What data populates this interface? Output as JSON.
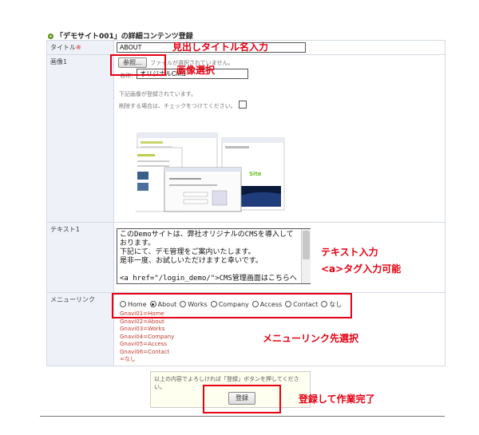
{
  "page": {
    "heading": "「デモサイト001」の詳細コンテンツ登録"
  },
  "form": {
    "title_label": "タイトル",
    "required_mark": "※",
    "title_value": "ABOUT",
    "image_label": "画像1",
    "browse_button": "参照...",
    "file_status": "ファイルが選択されていません。",
    "alt_label": "名称：",
    "alt_value": "オリジナルCMS",
    "registered_note": "下記画像が登録されています。",
    "delete_note": "削除する場合は、チェックをつけてください。",
    "text_label": "テキスト1",
    "text_value": "このDemoサイトは、弊社オリジナルのCMSを導入しております。\n下記にて、デモ管理をご案内いたします。\n是非一度、お試しいただけますと幸いです。\n\n<a href=\"/login_demo/\">CMS管理画面はこちらへ</a>\n<br>",
    "menu_label": "メニューリンク",
    "menu_options": [
      {
        "label": "Home",
        "checked": false
      },
      {
        "label": "About",
        "checked": true
      },
      {
        "label": "Works",
        "checked": false
      },
      {
        "label": "Company",
        "checked": false
      },
      {
        "label": "Access",
        "checked": false
      },
      {
        "label": "Contact",
        "checked": false
      },
      {
        "label": "なし",
        "checked": false
      }
    ],
    "menu_legend": [
      "Gnavi01=Home",
      "Gnavi02=About",
      "Gnavi03=Works",
      "Gnavi04=Company",
      "Gnavi05=Access",
      "Gnavi06=Contact",
      "=なし"
    ]
  },
  "submit": {
    "notice": "以上の内容でよろしければ「登録」ボタンを押してください。",
    "button": "登録"
  },
  "annotations": {
    "title_input": "見出しタイトル名入力",
    "image_select": "画像選択",
    "text_input_1": "テキスト入力",
    "text_input_2": "<a>タグ入力可能",
    "menu_select": "メニューリンク先選択",
    "register_done": "登録して作業完了"
  },
  "thumbnail": {
    "site_label": "Site"
  },
  "colors": {
    "annotation_red": "#e60012",
    "label_bg": "#eef1f7",
    "link_red": "#c0392b"
  }
}
